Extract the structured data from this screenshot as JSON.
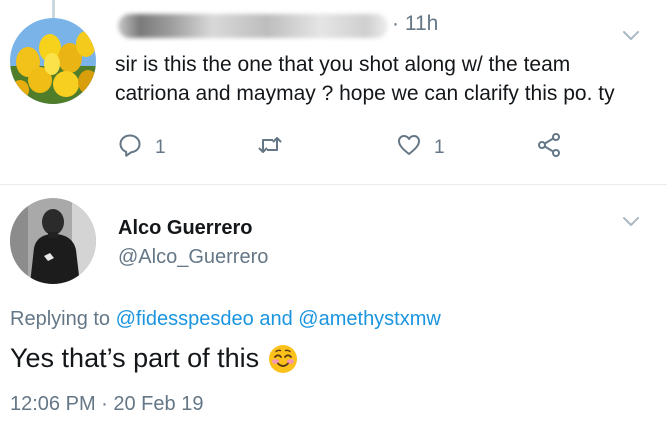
{
  "first_tweet": {
    "time": "· 11h",
    "text_line1": "sir is this the one that you shot along w/ the team",
    "text_line2": "catriona and maymay ?  hope we can clarify this po.  ty",
    "reply_count": "1",
    "like_count": "1"
  },
  "second_tweet": {
    "display_name": "Alco Guerrero",
    "handle": "@Alco_Guerrero",
    "replying_prefix": "Replying to",
    "replying_user1": "@fidesspesdeo",
    "replying_and": "and",
    "replying_user2": "@amethystxmw",
    "text": "Yes that’s part of this",
    "emoji": "smiling-face-with-smiling-eyes",
    "timestamp": "12:06 PM · 20 Feb 19"
  },
  "colors": {
    "link": "#1b95e0",
    "secondary_text": "#657786",
    "icon": "#657786"
  }
}
